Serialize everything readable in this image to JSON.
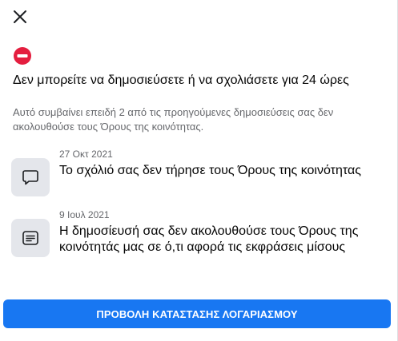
{
  "dialog": {
    "close_icon": "close-icon",
    "restriction_icon": "restriction-icon",
    "title": "Δεν μπορείτε να δημοσιεύσετε ή να σχολιάσετε για 24 ώρες",
    "description": "Αυτό συμβαίνει επειδή 2 από τις προηγούμενες δημοσιεύσεις σας δεν ακολουθούσε τους Όρους της κοινότητας.",
    "violations": [
      {
        "icon": "comment-icon",
        "date": "27 Οκτ 2021",
        "text": "Το σχόλιό σας δεν τήρησε τους Όρους της κοινότητας"
      },
      {
        "icon": "post-icon",
        "date": "9 Ιουλ 2021",
        "text": "Η δημοσίευσή σας δεν ακολουθούσε τους Όρους της κοινότητάς μας σε ό,τι αφορά τις εκφράσεις μίσους"
      }
    ],
    "button_label": "ΠΡΟΒΟΛΗ ΚΑΤΑΣΤΑΣΗΣ ΛΟΓΑΡΙΑΣΜΟΥ"
  },
  "colors": {
    "accent": "#1877f2",
    "restriction_red": "#e41e3f",
    "secondary_text": "#65676b",
    "icon_box": "#e4e6eb"
  }
}
